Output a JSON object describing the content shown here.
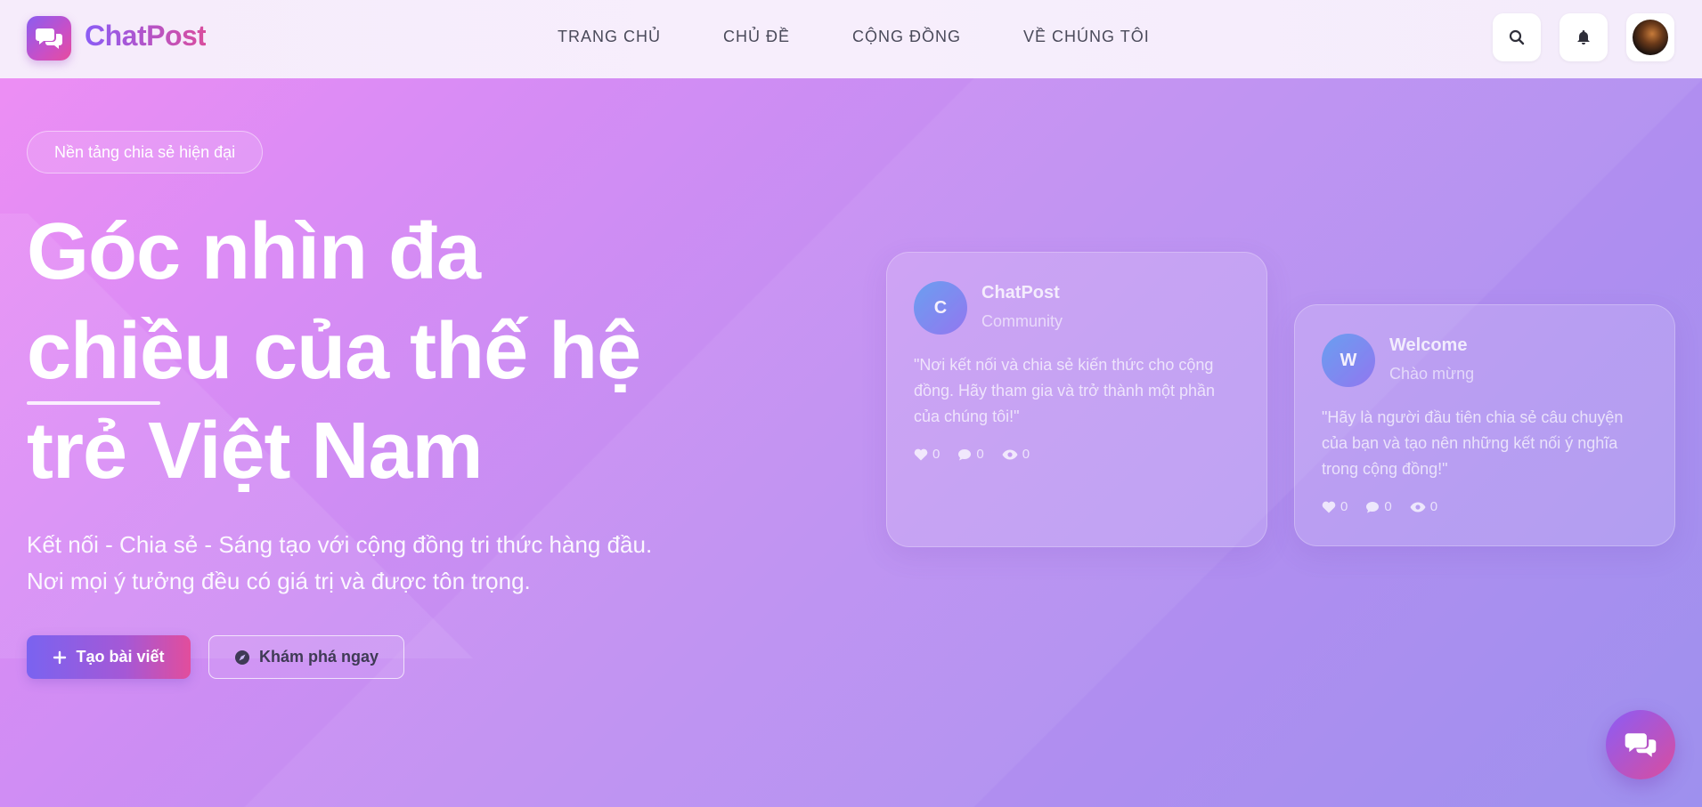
{
  "brand": {
    "name": "ChatPost",
    "icon": "chat-bubbles-icon",
    "gradient": [
      "#8b5cf6",
      "#d94d9e"
    ]
  },
  "nav": {
    "items": [
      {
        "label": "TRANG CHỦ"
      },
      {
        "label": "CHỦ ĐỀ"
      },
      {
        "label": "CỘNG ĐỒNG"
      },
      {
        "label": "VỀ CHÚNG TÔI"
      }
    ]
  },
  "header_actions": {
    "search_icon": "search-icon",
    "notification_icon": "bell-icon",
    "avatar": "user-avatar"
  },
  "hero": {
    "pill": "Nền tảng chia sẻ hiện đại",
    "headline_lines": [
      "Góc nhìn đa",
      "chiều của thế hệ",
      "trẻ Việt Nam"
    ],
    "subtitle_lines": [
      "Kết nối - Chia sẻ - Sáng tạo với cộng đồng tri thức hàng đầu.",
      "Nơi mọi ý tưởng đều có giá trị và được tôn trọng."
    ],
    "primary_button": "Tạo bài viết",
    "secondary_button": "Khám phá ngay"
  },
  "cards": [
    {
      "initial": "C",
      "name": "ChatPost",
      "subtitle": "Community",
      "quote": "\"Nơi kết nối và chia sẻ kiến thức cho cộng đồng. Hãy tham gia và trở thành một phần của chúng tôi!\"",
      "likes": "0",
      "comments": "0",
      "views": "0"
    },
    {
      "initial": "W",
      "name": "Welcome",
      "subtitle": "Chào mừng",
      "quote": "\"Hãy là người đầu tiên chia sẻ câu chuyện của bạn và tạo nên những kết nối ý nghĩa trong cộng đồng!\"",
      "likes": "0",
      "comments": "0",
      "views": "0"
    }
  ],
  "colors": {
    "accent": "#8b5cf6",
    "accent_pink": "#d94d9e",
    "background_start": "#f08ef4",
    "background_end": "#9e90ee"
  }
}
